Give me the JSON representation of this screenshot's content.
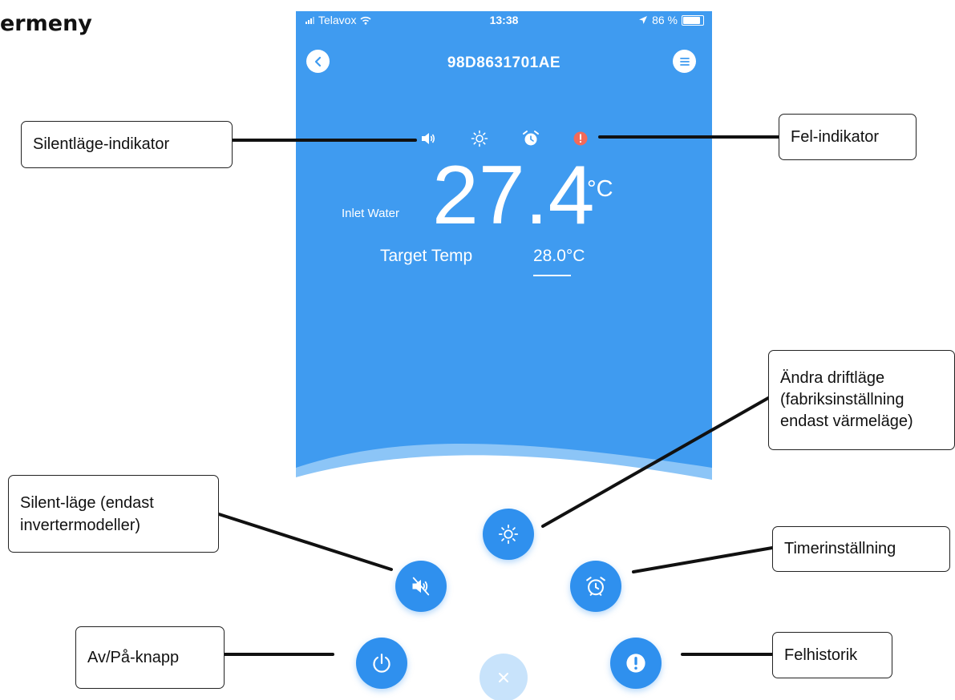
{
  "heading": "ermeny",
  "status_bar": {
    "carrier": "Telavox",
    "time": "13:38",
    "battery": "86 %"
  },
  "navbar": {
    "title": "98D8631701AE",
    "back_icon": "chevron-left-icon",
    "menu_icon": "menu-icon"
  },
  "indicators": [
    {
      "name": "silent-mode-indicator",
      "icon": "speaker-icon"
    },
    {
      "name": "heat-mode-indicator",
      "icon": "sun-icon"
    },
    {
      "name": "timer-indicator",
      "icon": "alarm-clock-icon"
    },
    {
      "name": "error-indicator",
      "icon": "error-dot-icon",
      "color": "#f26a5a"
    }
  ],
  "reading": {
    "label": "Inlet Water",
    "value": "27.4",
    "unit": "°C"
  },
  "target": {
    "label": "Target Temp",
    "value": "28.0°C"
  },
  "colors": {
    "primary": "#3f9bf0",
    "button": "#2f90ee",
    "error": "#f26a5a"
  },
  "buttons": [
    {
      "name": "mode-button",
      "icon": "sun-icon"
    },
    {
      "name": "silent-mode-button",
      "icon": "speaker-muted-icon"
    },
    {
      "name": "timer-button",
      "icon": "alarm-clock-icon"
    },
    {
      "name": "power-button",
      "icon": "power-icon"
    },
    {
      "name": "error-history-button",
      "icon": "exclamation-icon"
    },
    {
      "name": "close-button",
      "icon": "close-icon"
    }
  ],
  "callouts": {
    "silent_indicator": "Silentläge-indikator",
    "error_indicator": "Fel-indikator",
    "change_mode_1": "Ändra driftläge",
    "change_mode_2": "(fabriksinställning",
    "change_mode_3": "endast värmeläge)",
    "silent_mode_1": "Silent-läge (endast",
    "silent_mode_2": "invertermodeller)",
    "timer": "Timerinställning",
    "power": "Av/På-knapp",
    "error_history": "Felhistorik"
  }
}
